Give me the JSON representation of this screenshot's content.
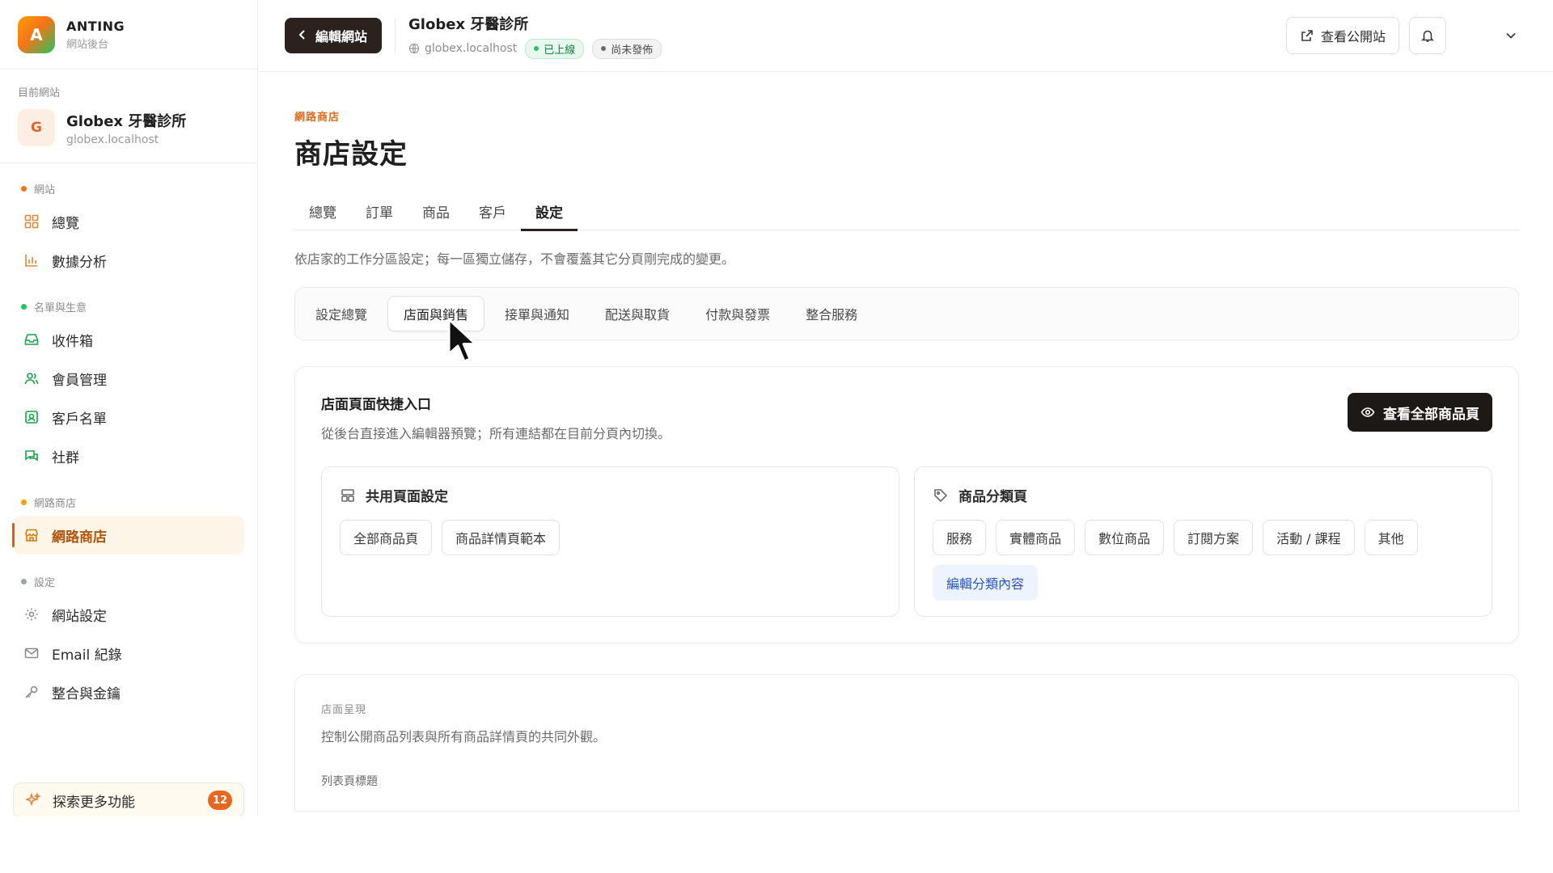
{
  "brand": {
    "logo_letter": "A",
    "name": "ANTING",
    "subtitle": "網站後台"
  },
  "current_site": {
    "label": "目前網站",
    "avatar_letter": "G",
    "name": "Globex 牙醫診所",
    "domain": "globex.localhost"
  },
  "sidebar": {
    "groups": [
      {
        "title": "網站",
        "dot_color": "#f97316",
        "items": [
          {
            "label": "總覽",
            "icon": "grid-icon"
          },
          {
            "label": "數據分析",
            "icon": "bar-chart-icon"
          }
        ]
      },
      {
        "title": "名單與生意",
        "dot_color": "#22c55e",
        "items": [
          {
            "label": "收件箱",
            "icon": "inbox-icon"
          },
          {
            "label": "會員管理",
            "icon": "users-icon"
          },
          {
            "label": "客戶名單",
            "icon": "contact-icon"
          },
          {
            "label": "社群",
            "icon": "chat-icon"
          }
        ]
      },
      {
        "title": "網路商店",
        "dot_color": "#f59e0b",
        "items": [
          {
            "label": "網路商店",
            "icon": "store-icon",
            "active": true
          }
        ]
      },
      {
        "title": "設定",
        "dot_color": "#9ca3af",
        "items": [
          {
            "label": "網站設定",
            "icon": "gear-icon"
          },
          {
            "label": "Email 紀錄",
            "icon": "mail-icon"
          },
          {
            "label": "整合與金鑰",
            "icon": "key-icon"
          }
        ]
      }
    ],
    "explore": {
      "label": "探索更多功能",
      "badge": "12",
      "icon": "sparkle-icon"
    }
  },
  "topbar": {
    "back_label": "編輯網站",
    "site_name": "Globex 牙醫診所",
    "site_domain": "globex.localhost",
    "status_live": "已上線",
    "status_unpublished": "尚未發佈",
    "view_public_label": "查看公開站"
  },
  "main": {
    "eyebrow": "網路商店",
    "title": "商店設定",
    "tabs": [
      "總覽",
      "訂單",
      "商品",
      "客戶",
      "設定"
    ],
    "active_tab": "設定",
    "description": "依店家的工作分區設定；每一區獨立儲存，不會覆蓋其它分頁剛完成的變更。",
    "subtabs": [
      "設定總覽",
      "店面與銷售",
      "接單與通知",
      "配送與取貨",
      "付款與發票",
      "整合服務"
    ],
    "active_subtab": "店面與銷售"
  },
  "shortcut_card": {
    "title": "店面頁面快捷入口",
    "subtitle": "從後台直接進入編輯器預覽；所有連結都在目前分頁內切換。",
    "button_label": "查看全部商品頁",
    "shared_panel": {
      "title": "共用頁面設定",
      "chips": [
        "全部商品頁",
        "商品詳情頁範本"
      ]
    },
    "category_panel": {
      "title": "商品分類頁",
      "chips": [
        "服務",
        "實體商品",
        "數位商品",
        "訂閱方案",
        "活動 / 課程",
        "其他"
      ],
      "edit_link": "編輯分類內容"
    }
  },
  "appearance_card": {
    "label": "店面呈現",
    "subtitle": "控制公開商品列表與所有商品詳情頁的共同外觀。",
    "field_label": "列表頁標題"
  },
  "colors": {
    "accent": "#ea580c",
    "dark": "#1c1917",
    "live": "#22c55e",
    "link": "#2b55c9"
  }
}
